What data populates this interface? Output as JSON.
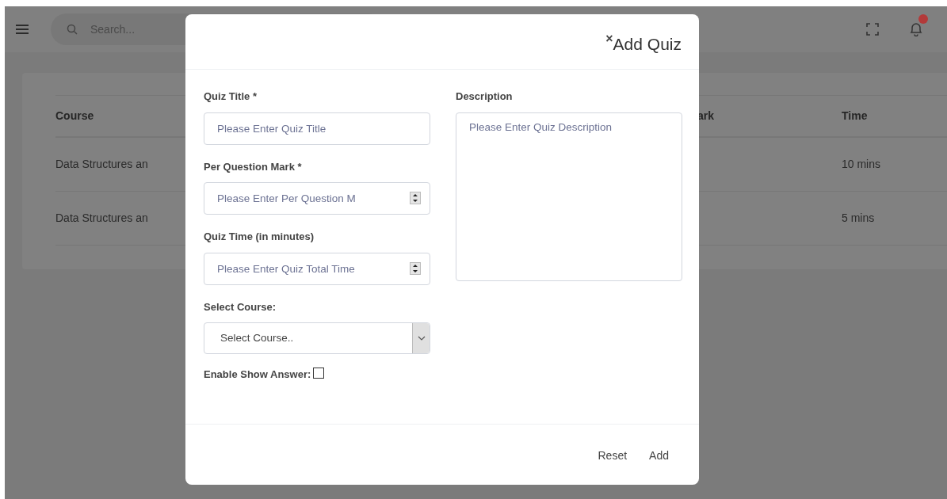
{
  "topbar": {
    "search": {
      "placeholder": "Search..."
    }
  },
  "table": {
    "columns": [
      "Course",
      "ark",
      "Time"
    ],
    "rows": [
      {
        "cells": [
          "Data Structures an",
          "",
          "10 mins"
        ]
      },
      {
        "cells": [
          "Data Structures an",
          "",
          "5 mins"
        ]
      }
    ]
  },
  "modal": {
    "close": "×",
    "title": "Add Quiz",
    "fields": [
      {
        "kind": "text",
        "label": "Quiz Title *",
        "placeholder": "Please Enter Quiz Title"
      },
      {
        "kind": "number",
        "label": "Per Question Mark *",
        "placeholder": "Please Enter Per Question M"
      },
      {
        "kind": "number",
        "label": "Quiz Time (in minutes)",
        "placeholder": "Please Enter Quiz Total Time"
      },
      {
        "kind": "select",
        "label": "Select Course:",
        "value": "Select Course.."
      },
      {
        "kind": "checkbox",
        "label": "Enable Show Answer:",
        "checked": false
      }
    ],
    "description": {
      "label": "Description",
      "placeholder": "Please Enter Quiz Description"
    },
    "buttons": [
      "Reset",
      "Add"
    ]
  }
}
